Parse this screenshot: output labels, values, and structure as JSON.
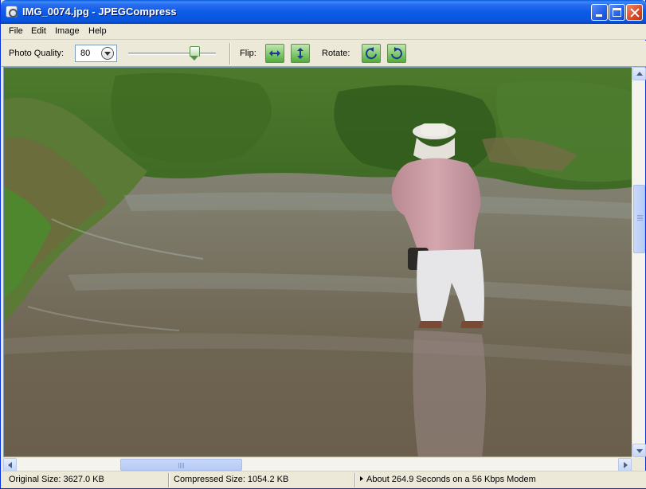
{
  "window": {
    "title": "IMG_0074.jpg - JPEGCompress"
  },
  "menu": {
    "items": [
      "File",
      "Edit",
      "Image",
      "Help"
    ]
  },
  "toolbar": {
    "quality_label": "Photo Quality:",
    "quality_value": "80",
    "quality_slider_level": 80,
    "flip_label": "Flip:",
    "rotate_label": "Rotate:",
    "icons": [
      "flip-horizontal-icon",
      "flip-vertical-icon",
      "rotate-left-icon",
      "rotate-right-icon"
    ],
    "button_color": "#4fae3a"
  },
  "image": {
    "description_icon": "photo-preview"
  },
  "status": {
    "original_size": "Original Size: 3627.0 KB",
    "compressed_size": "Compressed Size: 1054.2 KB",
    "transfer_time": "About 264.9 Seconds on a 56 Kbps Modem"
  },
  "colors": {
    "titlebar": "#0a55dc",
    "chrome": "#ece9d8"
  }
}
